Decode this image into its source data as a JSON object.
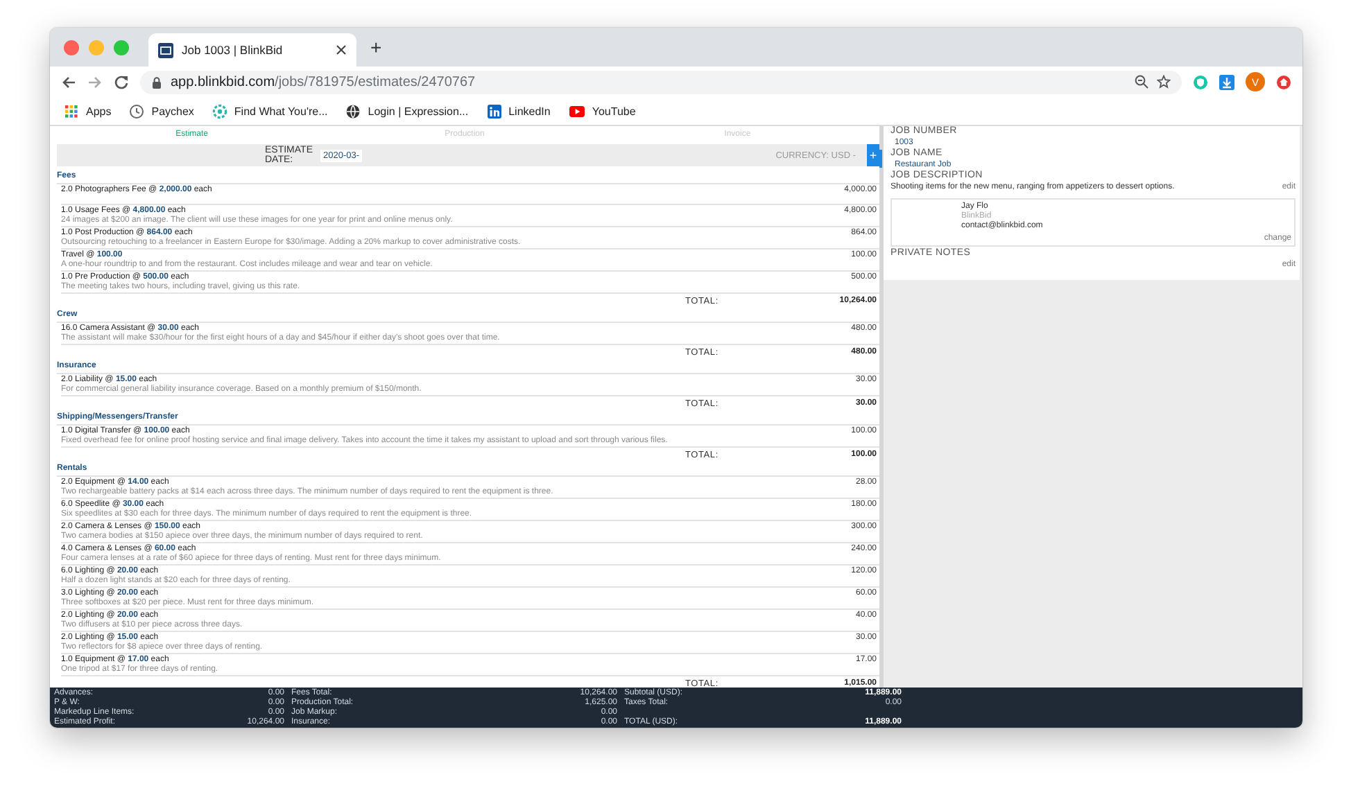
{
  "browser": {
    "tab_title": "Job 1003 | BlinkBid",
    "new_tab": "+",
    "address": {
      "host": "app.blinkbid.com",
      "path": "/jobs/781975/estimates/2470767"
    },
    "avatar": "V",
    "bookmarks": [
      {
        "label": "Apps"
      },
      {
        "label": "Paychex"
      },
      {
        "label": "Find What You're..."
      },
      {
        "label": "Login | Expression..."
      },
      {
        "label": "LinkedIn"
      },
      {
        "label": "YouTube"
      }
    ]
  },
  "estimate_tabs": [
    {
      "label": "Estimate",
      "selected": true
    },
    {
      "label": "Production",
      "selected": false
    },
    {
      "label": "Invoice",
      "selected": false
    }
  ],
  "estimate_header": {
    "date_label": "ESTIMATE DATE:",
    "date_value": "2020-03-",
    "currency": "CURRENCY: USD -",
    "add_button": "+"
  },
  "sections": [
    {
      "title": "Fees",
      "total_label": "TOTAL:",
      "total": "10,264.00",
      "items": [
        {
          "title": "2.0 Photographers Fee @ **2,000.00** each",
          "amount": "4,000.00"
        },
        {
          "title": "1.0 Usage Fees @ **4,800.00** each",
          "note": "24 images at $200 an image. The client will use these images for one year for print and online menus only.",
          "amount": "4,800.00"
        },
        {
          "title": "1.0 Post Production @ **864.00** each",
          "note": "Outsourcing retouching to a freelancer in Eastern Europe for $30/image. Adding a 20% markup to cover administrative costs.",
          "amount": "864.00"
        },
        {
          "title": "Travel @ **100.00**",
          "note": "A one-hour roundtrip to and from the restaurant. Cost includes mileage and wear and tear on vehicle.",
          "amount": "100.00"
        },
        {
          "title": "1.0 Pre Production @ **500.00** each",
          "note": "The meeting takes two hours, including travel, giving us this rate.",
          "amount": "500.00"
        }
      ]
    },
    {
      "title": "Crew",
      "total_label": "TOTAL:",
      "total": "480.00",
      "items": [
        {
          "title": "16.0 Camera Assistant @ **30.00** each",
          "note": "The assistant will make $30/hour for the first eight hours of a day and $45/hour if either day's shoot goes over that time.",
          "amount": "480.00"
        }
      ]
    },
    {
      "title": "Insurance",
      "total_label": "TOTAL:",
      "total": "30.00",
      "items": [
        {
          "title": "2.0 Liability @ **15.00** each",
          "note": "For commercial general liability insurance coverage. Based on a monthly premium of $150/month.",
          "amount": "30.00"
        }
      ]
    },
    {
      "title": "Shipping/Messengers/Transfer",
      "total_label": "TOTAL:",
      "total": "100.00",
      "items": [
        {
          "title": "1.0 Digital Transfer @ **100.00** each",
          "note": "Fixed overhead fee for online proof hosting service and final image delivery. Takes into account the time it takes my assistant to upload and sort through various files.",
          "amount": "100.00"
        }
      ]
    },
    {
      "title": "Rentals",
      "total_label": "TOTAL:",
      "total": "1,015.00",
      "items": [
        {
          "title": "2.0 Equipment @ **14.00** each",
          "note": "Two rechargeable battery packs at $14 each across three days. The minimum number of days required to rent the equipment is three.",
          "amount": "28.00"
        },
        {
          "title": "6.0 Speedlite @ **30.00** each",
          "note": "Six speedlites at $30 each for three days. The minimum number of days required to rent the equipment is three.",
          "amount": "180.00"
        },
        {
          "title": "2.0 Camera & Lenses @ **150.00** each",
          "note": "Two camera bodies at $150 apiece over three days, the minimum number of days required to rent.",
          "amount": "300.00"
        },
        {
          "title": "4.0 Camera & Lenses @ **60.00** each",
          "note": "Four camera lenses at a rate of $60 apiece for three days of renting. Must rent for three days minimum.",
          "amount": "240.00"
        },
        {
          "title": "6.0 Lighting @ **20.00** each",
          "note": "Half a dozen light stands at $20 each for three days of renting.",
          "amount": "120.00"
        },
        {
          "title": "3.0 Lighting @ **20.00** each",
          "note": "Three softboxes at $20 per piece. Must rent for three days minimum.",
          "amount": "60.00"
        },
        {
          "title": "2.0 Lighting @ **20.00** each",
          "note": "Two diffusers at $10 per piece across three days.",
          "amount": "40.00"
        },
        {
          "title": "2.0 Lighting @ **15.00** each",
          "note": "Two reflectors for $8 apiece over three days of renting.",
          "amount": "30.00"
        },
        {
          "title": "1.0 Equipment @ **17.00** each",
          "note": "One tripod at $17 for three days of renting.",
          "amount": "17.00"
        }
      ]
    }
  ],
  "job_panel": {
    "job_number_label": "JOB NUMBER",
    "job_number": "1003",
    "job_name_label": "JOB NAME",
    "job_name": "Restaurant Job",
    "description_label": "JOB DESCRIPTION",
    "description": "Shooting items for the new menu, ranging from appetizers to dessert options.",
    "description_edit": "edit",
    "contact": {
      "name": "Jay Flo",
      "company": "BlinkBid",
      "email": "contact@blinkbid.com",
      "change": "change"
    },
    "notes_label": "PRIVATE NOTES",
    "notes_edit": "edit"
  },
  "summary": {
    "rows": [
      [
        {
          "label": "Advances:",
          "value": "0.00",
          "strong": false
        },
        {
          "label": "Fees Total:",
          "value": "10,264.00",
          "strong": false
        },
        {
          "label": "Subtotal (USD):",
          "value": "11,889.00",
          "strong": true
        }
      ],
      [
        {
          "label": "P & W:",
          "value": "0.00",
          "strong": false
        },
        {
          "label": "Production Total:",
          "value": "1,625.00",
          "strong": false
        },
        {
          "label": "Taxes Total:",
          "value": "0.00",
          "strong": false
        }
      ],
      [
        {
          "label": "Markedup Line Items:",
          "value": "0.00",
          "strong": false
        },
        {
          "label": "Job Markup:",
          "value": "0.00",
          "strong": false
        }
      ],
      [
        {
          "label": "Estimated Profit:",
          "value": "10,264.00",
          "strong": false
        },
        {
          "label": "Insurance:",
          "value": "0.00",
          "strong": false
        },
        {
          "label": "TOTAL (USD):",
          "value": "11,889.00",
          "strong": true
        }
      ]
    ]
  }
}
